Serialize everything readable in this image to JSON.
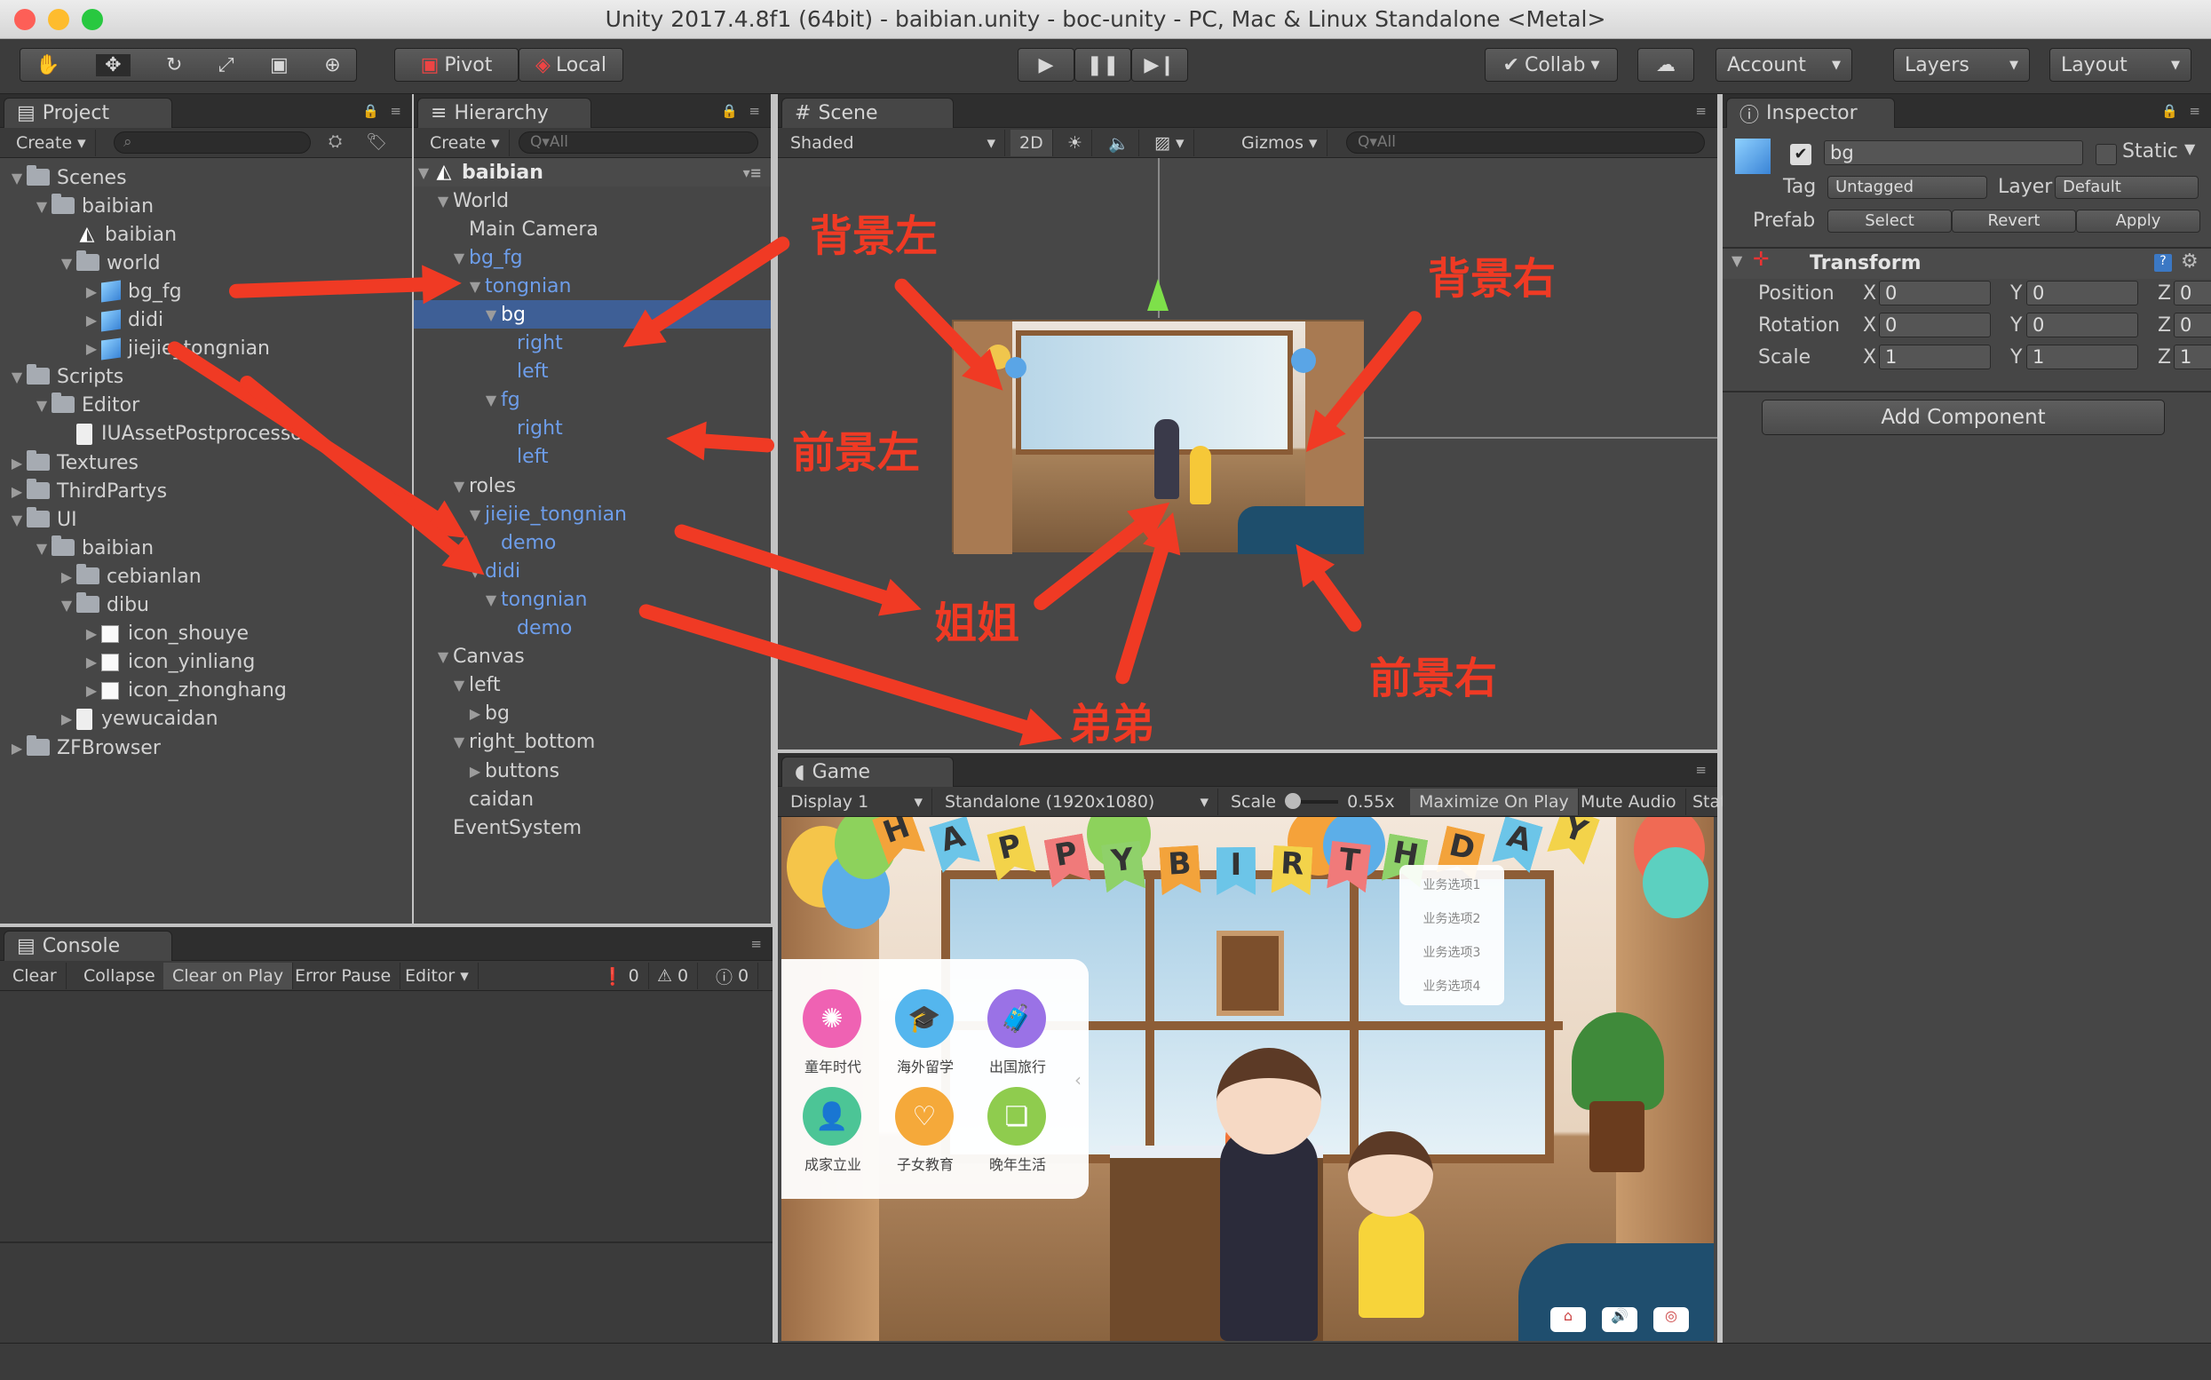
{
  "window": {
    "title": "Unity 2017.4.8f1 (64bit) - baibian.unity - boc-unity - PC, Mac & Linux Standalone <Metal>"
  },
  "toolbar": {
    "pivot": "Pivot",
    "local": "Local",
    "collab": "Collab",
    "account": "Account",
    "layers": "Layers",
    "layout": "Layout"
  },
  "project": {
    "tab": "Project",
    "create": "Create",
    "items": [
      {
        "label": "Scenes",
        "depth": 0,
        "icon": "folder",
        "exp": "▼"
      },
      {
        "label": "baibian",
        "depth": 1,
        "icon": "folder",
        "exp": "▼"
      },
      {
        "label": "baibian",
        "depth": 2,
        "icon": "unity",
        "exp": ""
      },
      {
        "label": "world",
        "depth": 2,
        "icon": "folder",
        "exp": "▼"
      },
      {
        "label": "bg_fg",
        "depth": 3,
        "icon": "cube",
        "exp": "▶"
      },
      {
        "label": "didi",
        "depth": 3,
        "icon": "cube",
        "exp": "▶"
      },
      {
        "label": "jiejie_tongnian",
        "depth": 3,
        "icon": "cube",
        "exp": "▶"
      },
      {
        "label": "Scripts",
        "depth": 0,
        "icon": "folder",
        "exp": "▼"
      },
      {
        "label": "Editor",
        "depth": 1,
        "icon": "folder",
        "exp": "▼"
      },
      {
        "label": "IUAssetPostprocessor",
        "depth": 2,
        "icon": "file",
        "exp": ""
      },
      {
        "label": "Textures",
        "depth": 0,
        "icon": "folder",
        "exp": "▶"
      },
      {
        "label": "ThirdPartys",
        "depth": 0,
        "icon": "folder",
        "exp": "▶"
      },
      {
        "label": "UI",
        "depth": 0,
        "icon": "folder",
        "exp": "▼"
      },
      {
        "label": "baibian",
        "depth": 1,
        "icon": "folder",
        "exp": "▼"
      },
      {
        "label": "cebianlan",
        "depth": 2,
        "icon": "folder",
        "exp": "▶"
      },
      {
        "label": "dibu",
        "depth": 2,
        "icon": "folder",
        "exp": "▼"
      },
      {
        "label": "icon_shouye",
        "depth": 3,
        "icon": "img",
        "exp": "▶"
      },
      {
        "label": "icon_yinliang",
        "depth": 3,
        "icon": "img",
        "exp": "▶"
      },
      {
        "label": "icon_zhonghang",
        "depth": 3,
        "icon": "img",
        "exp": "▶"
      },
      {
        "label": "yewucaidan",
        "depth": 2,
        "icon": "file",
        "exp": "▶"
      },
      {
        "label": "ZFBrowser",
        "depth": 0,
        "icon": "folder",
        "exp": "▶"
      }
    ]
  },
  "hierarchy": {
    "tab": "Hierarchy",
    "create": "Create",
    "search": "Q▾All",
    "scene": "baibian",
    "items": [
      {
        "label": "World",
        "depth": 1,
        "exp": "▼",
        "blue": false,
        "sel": false
      },
      {
        "label": "Main Camera",
        "depth": 2,
        "exp": "",
        "blue": false,
        "sel": false
      },
      {
        "label": "bg_fg",
        "depth": 2,
        "exp": "▼",
        "blue": true,
        "sel": false
      },
      {
        "label": "tongnian",
        "depth": 3,
        "exp": "▼",
        "blue": true,
        "sel": false
      },
      {
        "label": "bg",
        "depth": 4,
        "exp": "▼",
        "blue": false,
        "sel": true
      },
      {
        "label": "right",
        "depth": 5,
        "exp": "",
        "blue": true,
        "sel": false
      },
      {
        "label": "left",
        "depth": 5,
        "exp": "",
        "blue": true,
        "sel": false
      },
      {
        "label": "fg",
        "depth": 4,
        "exp": "▼",
        "blue": true,
        "sel": false
      },
      {
        "label": "right",
        "depth": 5,
        "exp": "",
        "blue": true,
        "sel": false
      },
      {
        "label": "left",
        "depth": 5,
        "exp": "",
        "blue": true,
        "sel": false
      },
      {
        "label": "roles",
        "depth": 2,
        "exp": "▼",
        "blue": false,
        "sel": false
      },
      {
        "label": "jiejie_tongnian",
        "depth": 3,
        "exp": "▼",
        "blue": true,
        "sel": false
      },
      {
        "label": "demo",
        "depth": 4,
        "exp": "",
        "blue": true,
        "sel": false
      },
      {
        "label": "didi",
        "depth": 3,
        "exp": "▼",
        "blue": true,
        "sel": false
      },
      {
        "label": "tongnian",
        "depth": 4,
        "exp": "▼",
        "blue": true,
        "sel": false
      },
      {
        "label": "demo",
        "depth": 5,
        "exp": "",
        "blue": true,
        "sel": false
      },
      {
        "label": "Canvas",
        "depth": 1,
        "exp": "▼",
        "blue": false,
        "sel": false
      },
      {
        "label": "left",
        "depth": 2,
        "exp": "▼",
        "blue": false,
        "sel": false
      },
      {
        "label": "bg",
        "depth": 3,
        "exp": "▶",
        "blue": false,
        "sel": false
      },
      {
        "label": "right_bottom",
        "depth": 2,
        "exp": "▼",
        "blue": false,
        "sel": false
      },
      {
        "label": "buttons",
        "depth": 3,
        "exp": "▶",
        "blue": false,
        "sel": false
      },
      {
        "label": "caidan",
        "depth": 2,
        "exp": "",
        "blue": false,
        "sel": false
      },
      {
        "label": "EventSystem",
        "depth": 1,
        "exp": "",
        "blue": false,
        "sel": false
      }
    ]
  },
  "scene": {
    "tab": "Scene",
    "shaded": "Shaded",
    "mode2d": "2D",
    "gizmos": "Gizmos",
    "search": "Q▾All"
  },
  "game": {
    "tab": "Game",
    "display": "Display 1",
    "resolution": "Standalone (1920x1080)",
    "scale_label": "Scale",
    "scale_value": "0.55x",
    "maximize": "Maximize On Play",
    "mute": "Mute Audio",
    "stats": "Stat",
    "banner": [
      "H",
      "A",
      "P",
      "P",
      "Y",
      "B",
      "I",
      "R",
      "T",
      "H",
      "D",
      "A",
      "Y"
    ],
    "menu_items": [
      "业务选项1",
      "业务选项2",
      "业务选项3",
      "业务选项4"
    ],
    "services": [
      "童年时代",
      "海外留学",
      "出国旅行",
      "成家立业",
      "子女教育",
      "晚年生活"
    ]
  },
  "console": {
    "tab": "Console",
    "clear": "Clear",
    "collapse": "Collapse",
    "clear_on_play": "Clear on Play",
    "error_pause": "Error Pause",
    "editor": "Editor",
    "count_errors": "0",
    "count_warnings": "0",
    "count_logs": "0"
  },
  "inspector": {
    "tab": "Inspector",
    "name": "bg",
    "static": "Static",
    "tag_label": "Tag",
    "tag_value": "Untagged",
    "layer_label": "Layer",
    "layer_value": "Default",
    "prefab_label": "Prefab",
    "prefab_select": "Select",
    "prefab_revert": "Revert",
    "prefab_apply": "Apply",
    "transform": "Transform",
    "rows": [
      {
        "label": "Position",
        "x": "0",
        "y": "0",
        "z": "0"
      },
      {
        "label": "Rotation",
        "x": "0",
        "y": "0",
        "z": "0"
      },
      {
        "label": "Scale",
        "x": "1",
        "y": "1",
        "z": "1"
      }
    ],
    "axis_x": "X",
    "axis_y": "Y",
    "axis_z": "Z",
    "add_component": "Add Component"
  },
  "annotations": {
    "bg_left": "背景左",
    "bg_right": "背景右",
    "fg_left": "前景左",
    "fg_right": "前景右",
    "sister": "姐姐",
    "brother": "弟弟"
  },
  "colors": {
    "annotation": "#f03a24",
    "selection": "#3e5f96",
    "link_blue": "#6d9dea"
  }
}
